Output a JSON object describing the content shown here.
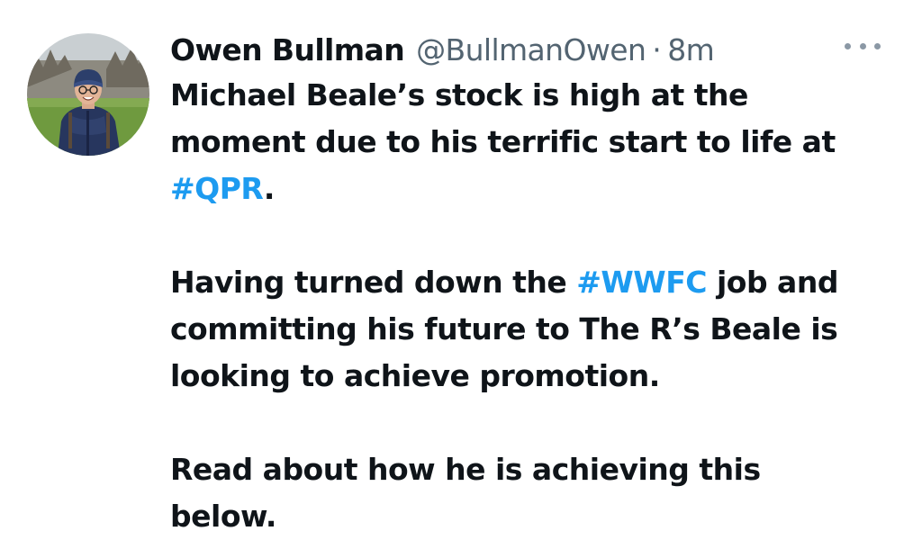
{
  "author": {
    "display_name": "Owen Bullman",
    "handle": "@BullmanOwen",
    "separator": "·",
    "time": "8m",
    "avatar_icon": "profile-photo-avatar"
  },
  "more_icon": "more-options-icon",
  "tweet": {
    "para1_line1": "Michael Beale’s stock is high at the",
    "para1_line2": "moment due to his terrific start to life at",
    "para1_hashtag": "#QPR",
    "para1_end": ".",
    "para2_line1_pre": "Having turned down the ",
    "para2_hashtag": "#WWFC",
    "para2_line1_post": " job and",
    "para2_line2": "committing his future to The R’s Beale is",
    "para2_line3": "looking to achieve promotion.",
    "para3_line1": "Read about how he is achieving this",
    "para3_line2": "below."
  },
  "colors": {
    "link": "#1d9bf0",
    "text": "#0f1419",
    "secondary": "#536471"
  }
}
